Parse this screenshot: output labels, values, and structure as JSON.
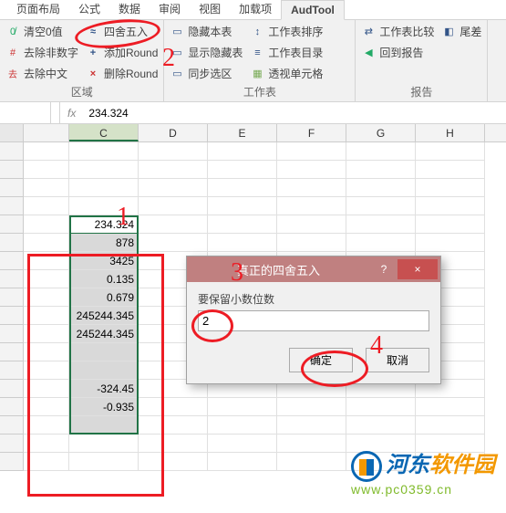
{
  "ribbon": {
    "tabs": [
      "页面布局",
      "公式",
      "数据",
      "审阅",
      "视图",
      "加载项",
      "AudTool"
    ],
    "active_tab": "AudTool",
    "group_area": {
      "label": "区域",
      "clear_zero": "清空0值",
      "remove_nondigit": "去除非数字",
      "remove_chinese": "去除中文",
      "round45": "四舍五入",
      "add_round": "添加Round",
      "del_round": "删除Round"
    },
    "group_worksheet": {
      "label": "工作表",
      "hide_sheet": "隐藏本表",
      "show_hidden": "显示隐藏表",
      "sync_sel": "同步选区",
      "sheet_sort": "工作表排序",
      "sheet_toc": "工作表目录",
      "trans_cell": "透视单元格"
    },
    "group_report": {
      "label": "报告",
      "compare_sheets": "工作表比较",
      "back_report": "回到报告",
      "tail_diff": "尾差"
    }
  },
  "formula": {
    "namebox": "",
    "fx": "fx",
    "value": "234.324"
  },
  "columns": [
    "C",
    "D",
    "E",
    "F",
    "G",
    "H"
  ],
  "selected_column": "C",
  "cells": {
    "col_c": [
      "",
      "",
      "",
      "",
      "234.324",
      "878",
      "3425",
      "0.135",
      "0.679",
      "245244.345",
      "245244.345",
      "",
      "",
      "-324.45",
      "-0.935",
      "",
      ""
    ]
  },
  "dialog": {
    "title": "真正的四舍五入",
    "label": "要保留小数位数",
    "value": "2",
    "ok": "确定",
    "cancel": "取消",
    "help": "?",
    "close": "×"
  },
  "annotations": {
    "a1": "1",
    "a2": "2",
    "a3": "3",
    "a4": "4"
  },
  "watermark": {
    "line1a": "河东",
    "line1b": "软件园",
    "line2": "www.pc0359.cn"
  }
}
